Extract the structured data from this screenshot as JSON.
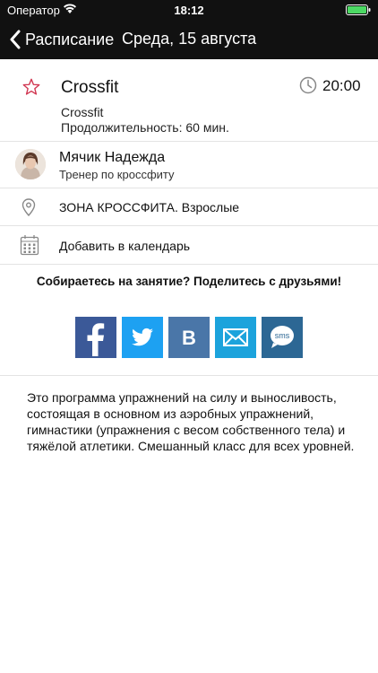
{
  "status_bar": {
    "carrier": "Оператор",
    "time": "18:12"
  },
  "nav": {
    "back_label": "Расписание",
    "title": "Среда, 15 августа"
  },
  "class_info": {
    "name": "Crossfit",
    "time": "20:00",
    "subtitle": "Crossfit",
    "duration": "Продолжительность: 60 мин."
  },
  "trainer": {
    "name": "Мячик Надежда",
    "role": "Тренер по кроссфиту"
  },
  "location": {
    "text": "ЗОНА КРОССФИТА. Взрослые"
  },
  "calendar": {
    "label": "Добавить в календарь"
  },
  "share": {
    "title": "Собираетесь на занятие? Поделитесь с друзьями!",
    "buttons": [
      {
        "icon": "facebook-icon",
        "color": "#3b5998",
        "glyph": "f"
      },
      {
        "icon": "twitter-icon",
        "color": "#1da1f2"
      },
      {
        "icon": "vk-icon",
        "color": "#4a76a8",
        "glyph": "В"
      },
      {
        "icon": "email-icon",
        "color": "#1ca3dc"
      },
      {
        "icon": "sms-icon",
        "color": "#2c6794",
        "glyph": "sms"
      }
    ]
  },
  "description": "Это программа упражнений на силу и выносливость, состоящая в основном из аэробных упражнений, гимнастики (упражнения с весом собственного тела) и тяжёлой атлетики. Смешанный класс для всех уровней."
}
